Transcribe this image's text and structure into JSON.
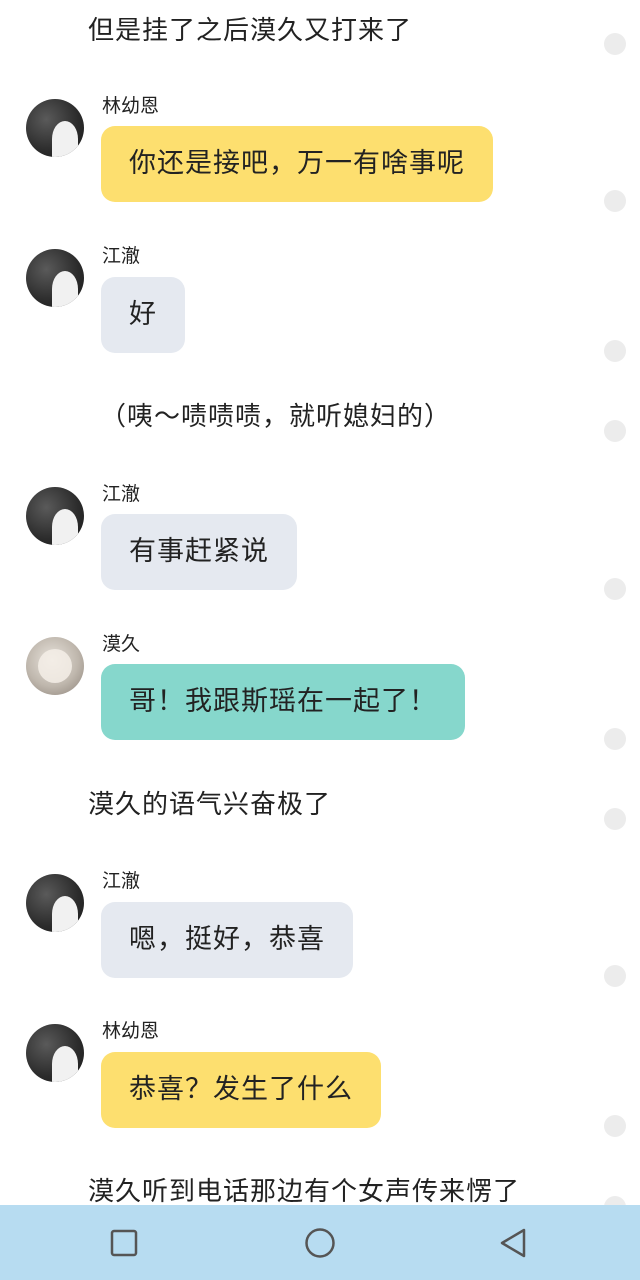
{
  "colors": {
    "yellow_bubble": "#fddf6f",
    "gray_bubble": "#e5e9f0",
    "teal_bubble": "#86d7cc",
    "navbar": "#b7dcf1"
  },
  "narration": [
    "但是挂了之后漠久又打来了",
    "（咦～啧啧啧，就听媳妇的）",
    "漠久的语气兴奋极了",
    "漠久听到电话那边有个女声传来愣了"
  ],
  "messages": [
    {
      "sender": "林幼恩",
      "text": "你还是接吧，万一有啥事呢",
      "avatar": "avatar-lin"
    },
    {
      "sender": "江澈",
      "text": "好",
      "avatar": "avatar-jiang"
    },
    {
      "sender": "江澈",
      "text": "有事赶紧说",
      "avatar": "avatar-jiang"
    },
    {
      "sender": "漠久",
      "text": "哥！我跟斯瑶在一起了！",
      "avatar": "avatar-mo"
    },
    {
      "sender": "江澈",
      "text": "嗯，挺好，恭喜",
      "avatar": "avatar-jiang"
    },
    {
      "sender": "林幼恩",
      "text": "恭喜？发生了什么",
      "avatar": "avatar-lin"
    }
  ],
  "navbar": {
    "buttons": [
      "recent-apps-square-icon",
      "home-circle-icon",
      "back-triangle-icon"
    ]
  }
}
